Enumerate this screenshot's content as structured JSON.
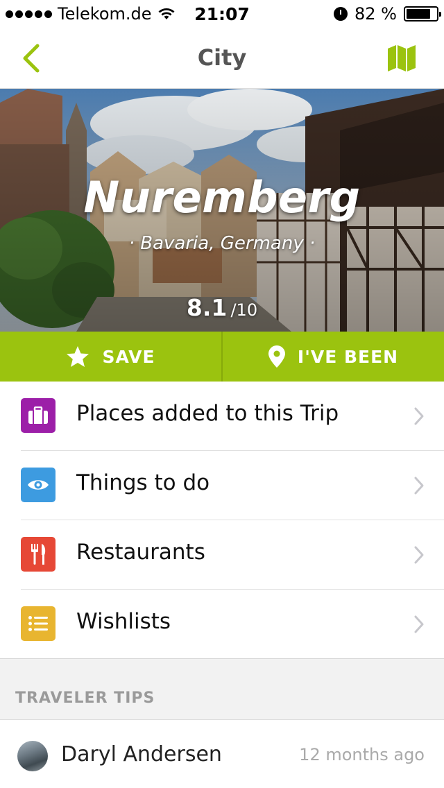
{
  "status_bar": {
    "carrier": "Telekom.de",
    "time": "21:07",
    "battery_percent": "82 %",
    "battery_level": 0.82
  },
  "nav": {
    "title": "City",
    "back_icon": "chevron-left-icon",
    "map_icon": "map-icon",
    "accent_color": "#9bc30f"
  },
  "hero": {
    "city": "Nuremberg",
    "region": "· Bavaria, Germany ·",
    "rating": "8.1",
    "rating_suffix": "/10"
  },
  "actions": {
    "save_label": "SAVE",
    "been_label": "I'VE BEEN",
    "background_color": "#9bc30f"
  },
  "menu": {
    "items": [
      {
        "label": "Places added to this Trip",
        "icon": "briefcase-icon",
        "color": "#9c1fa8"
      },
      {
        "label": "Things to do",
        "icon": "eye-icon",
        "color": "#3d9be0"
      },
      {
        "label": "Restaurants",
        "icon": "fork-knife-icon",
        "color": "#e64836"
      },
      {
        "label": "Wishlists",
        "icon": "list-icon",
        "color": "#e8b530"
      }
    ]
  },
  "tips": {
    "header": "TRAVELER TIPS",
    "entries": [
      {
        "author": "Daryl Andersen",
        "time": "12 months ago"
      }
    ]
  }
}
